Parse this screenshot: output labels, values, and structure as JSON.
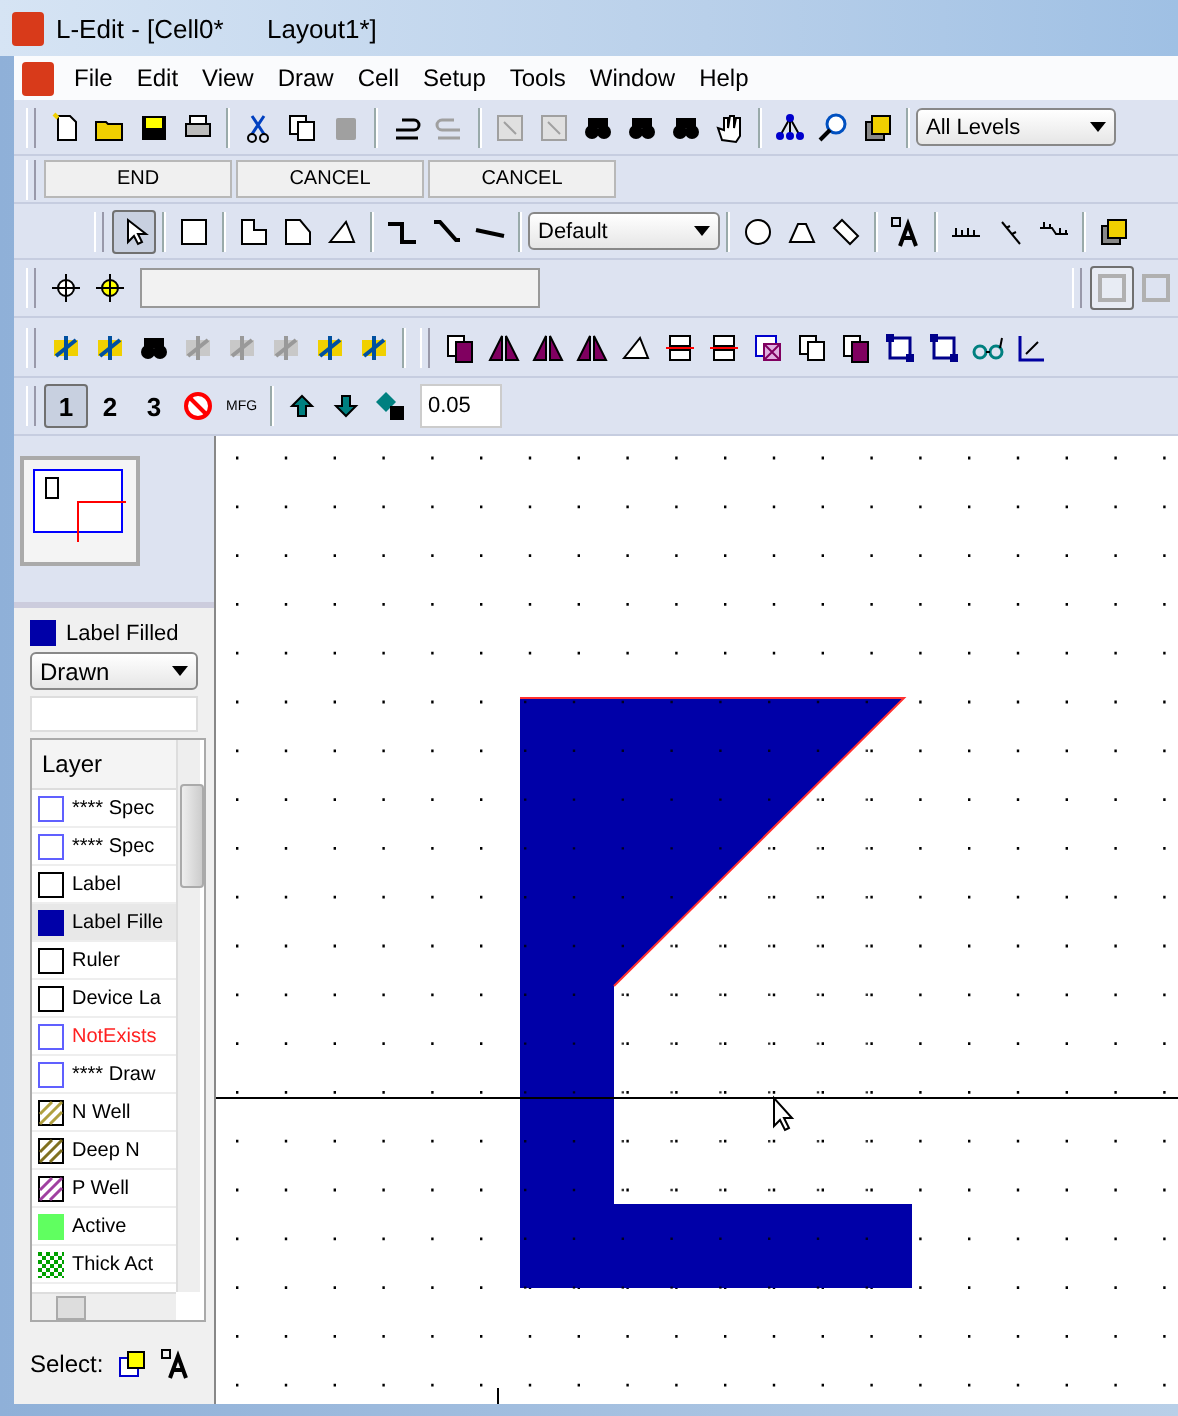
{
  "window": {
    "title": "L-Edit - [Cell0*      Layout1*]"
  },
  "menu": [
    "File",
    "Edit",
    "View",
    "Draw",
    "Cell",
    "Setup",
    "Tools",
    "Window",
    "Help"
  ],
  "toolbar_main": {
    "items": [
      {
        "disabled": false
      },
      {
        "disabled": false
      },
      {
        "disabled": false
      },
      {
        "disabled": false
      },
      {
        "disabled": false
      },
      {
        "disabled": false
      },
      {
        "disabled": true
      },
      {
        "disabled": false
      },
      {
        "disabled": true
      },
      {
        "disabled": true
      },
      {
        "disabled": true
      },
      {
        "disabled": false
      },
      {
        "disabled": false
      },
      {
        "disabled": false
      },
      {
        "disabled": false
      },
      {
        "disabled": false
      },
      {
        "disabled": false
      },
      {
        "disabled": false
      }
    ],
    "levels_dropdown": "All Levels"
  },
  "command_buttons": [
    "END",
    "CANCEL",
    "CANCEL"
  ],
  "draw_toolbar": {
    "style_dropdown": "Default"
  },
  "edit_toolbar": {
    "items": [
      {
        "disabled": false
      },
      {
        "disabled": false
      },
      {
        "disabled": false
      },
      {
        "disabled": true
      },
      {
        "disabled": true
      },
      {
        "disabled": true
      },
      {
        "disabled": false
      },
      {
        "disabled": false
      }
    ]
  },
  "grid_toolbar": {
    "grid_buttons": [
      {
        "label": "1",
        "selected": true
      },
      {
        "label": "2",
        "selected": false
      },
      {
        "label": "3",
        "selected": false
      }
    ],
    "mfg_label": "MFG",
    "value": "0.05"
  },
  "layer_panel": {
    "current_layer": {
      "label": "Label Filled",
      "color": "#0000a8"
    },
    "mode_dropdown": "Drawn",
    "header": "Layer",
    "layers": [
      {
        "label": "**** Spec",
        "kind": "outline",
        "color": "#6060ff",
        "missing": false,
        "selected": false
      },
      {
        "label": "**** Spec",
        "kind": "outline",
        "color": "#6060ff",
        "missing": false,
        "selected": false
      },
      {
        "label": "Label",
        "kind": "outline",
        "color": "#000000",
        "missing": false,
        "selected": false
      },
      {
        "label": "Label Fille",
        "kind": "filled",
        "color": "#0000a8",
        "missing": false,
        "selected": true
      },
      {
        "label": "Ruler",
        "kind": "outline",
        "color": "#000000",
        "missing": false,
        "selected": false
      },
      {
        "label": "Device La",
        "kind": "outline",
        "color": "#000000",
        "missing": false,
        "selected": false
      },
      {
        "label": "NotExists",
        "kind": "outline",
        "color": "#6060ff",
        "missing": true,
        "selected": false
      },
      {
        "label": "**** Draw",
        "kind": "outline",
        "color": "#6060ff",
        "missing": false,
        "selected": false
      },
      {
        "label": "N Well",
        "kind": "hatched",
        "color": "#b0a040",
        "missing": false,
        "selected": false
      },
      {
        "label": "Deep N",
        "kind": "hatched",
        "color": "#807020",
        "missing": false,
        "selected": false
      },
      {
        "label": "P Well",
        "kind": "hatched",
        "color": "#a040a0",
        "missing": false,
        "selected": false
      },
      {
        "label": "Active",
        "kind": "filled",
        "color": "#60ff60",
        "missing": false,
        "selected": false
      },
      {
        "label": "Thick Act",
        "kind": "checker",
        "color": "#00a000",
        "missing": false,
        "selected": false
      }
    ],
    "select_label": "Select:"
  }
}
